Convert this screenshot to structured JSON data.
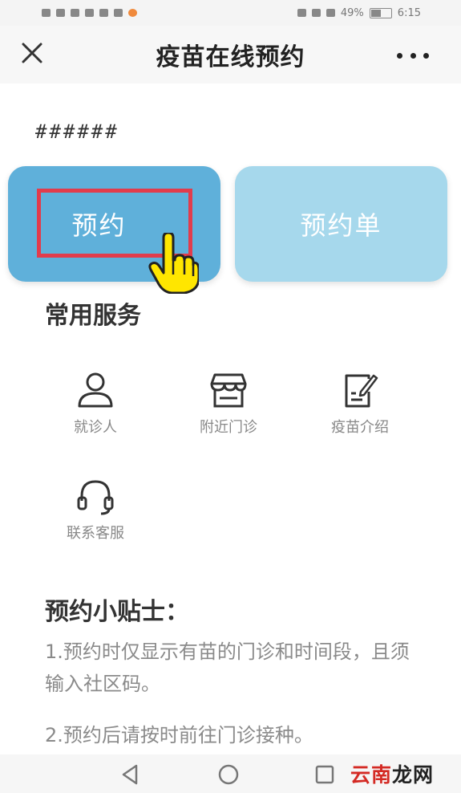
{
  "status_bar": {
    "battery": "49%",
    "time": "6:15"
  },
  "header": {
    "title": "疫苗在线预约"
  },
  "masked_text": "######",
  "cards": {
    "book": "预约",
    "list": "预约单"
  },
  "services": {
    "title": "常用服务",
    "items": [
      {
        "label": "就诊人",
        "icon": "person-icon"
      },
      {
        "label": "附近门诊",
        "icon": "store-icon"
      },
      {
        "label": "疫苗介绍",
        "icon": "document-edit-icon"
      },
      {
        "label": "联系客服",
        "icon": "headset-icon"
      }
    ]
  },
  "tips": {
    "title": "预约小贴士：",
    "items": [
      "1.预约时仅显示有苗的门诊和时间段，且须输入社区码。",
      "2.预约后请按时前往门诊接种。"
    ]
  },
  "watermark": {
    "part1": "云南",
    "part2": "龙网"
  },
  "colors": {
    "primary_card": "#5fb0da",
    "secondary_card": "#a6d8ec",
    "highlight": "#e23c4c"
  }
}
